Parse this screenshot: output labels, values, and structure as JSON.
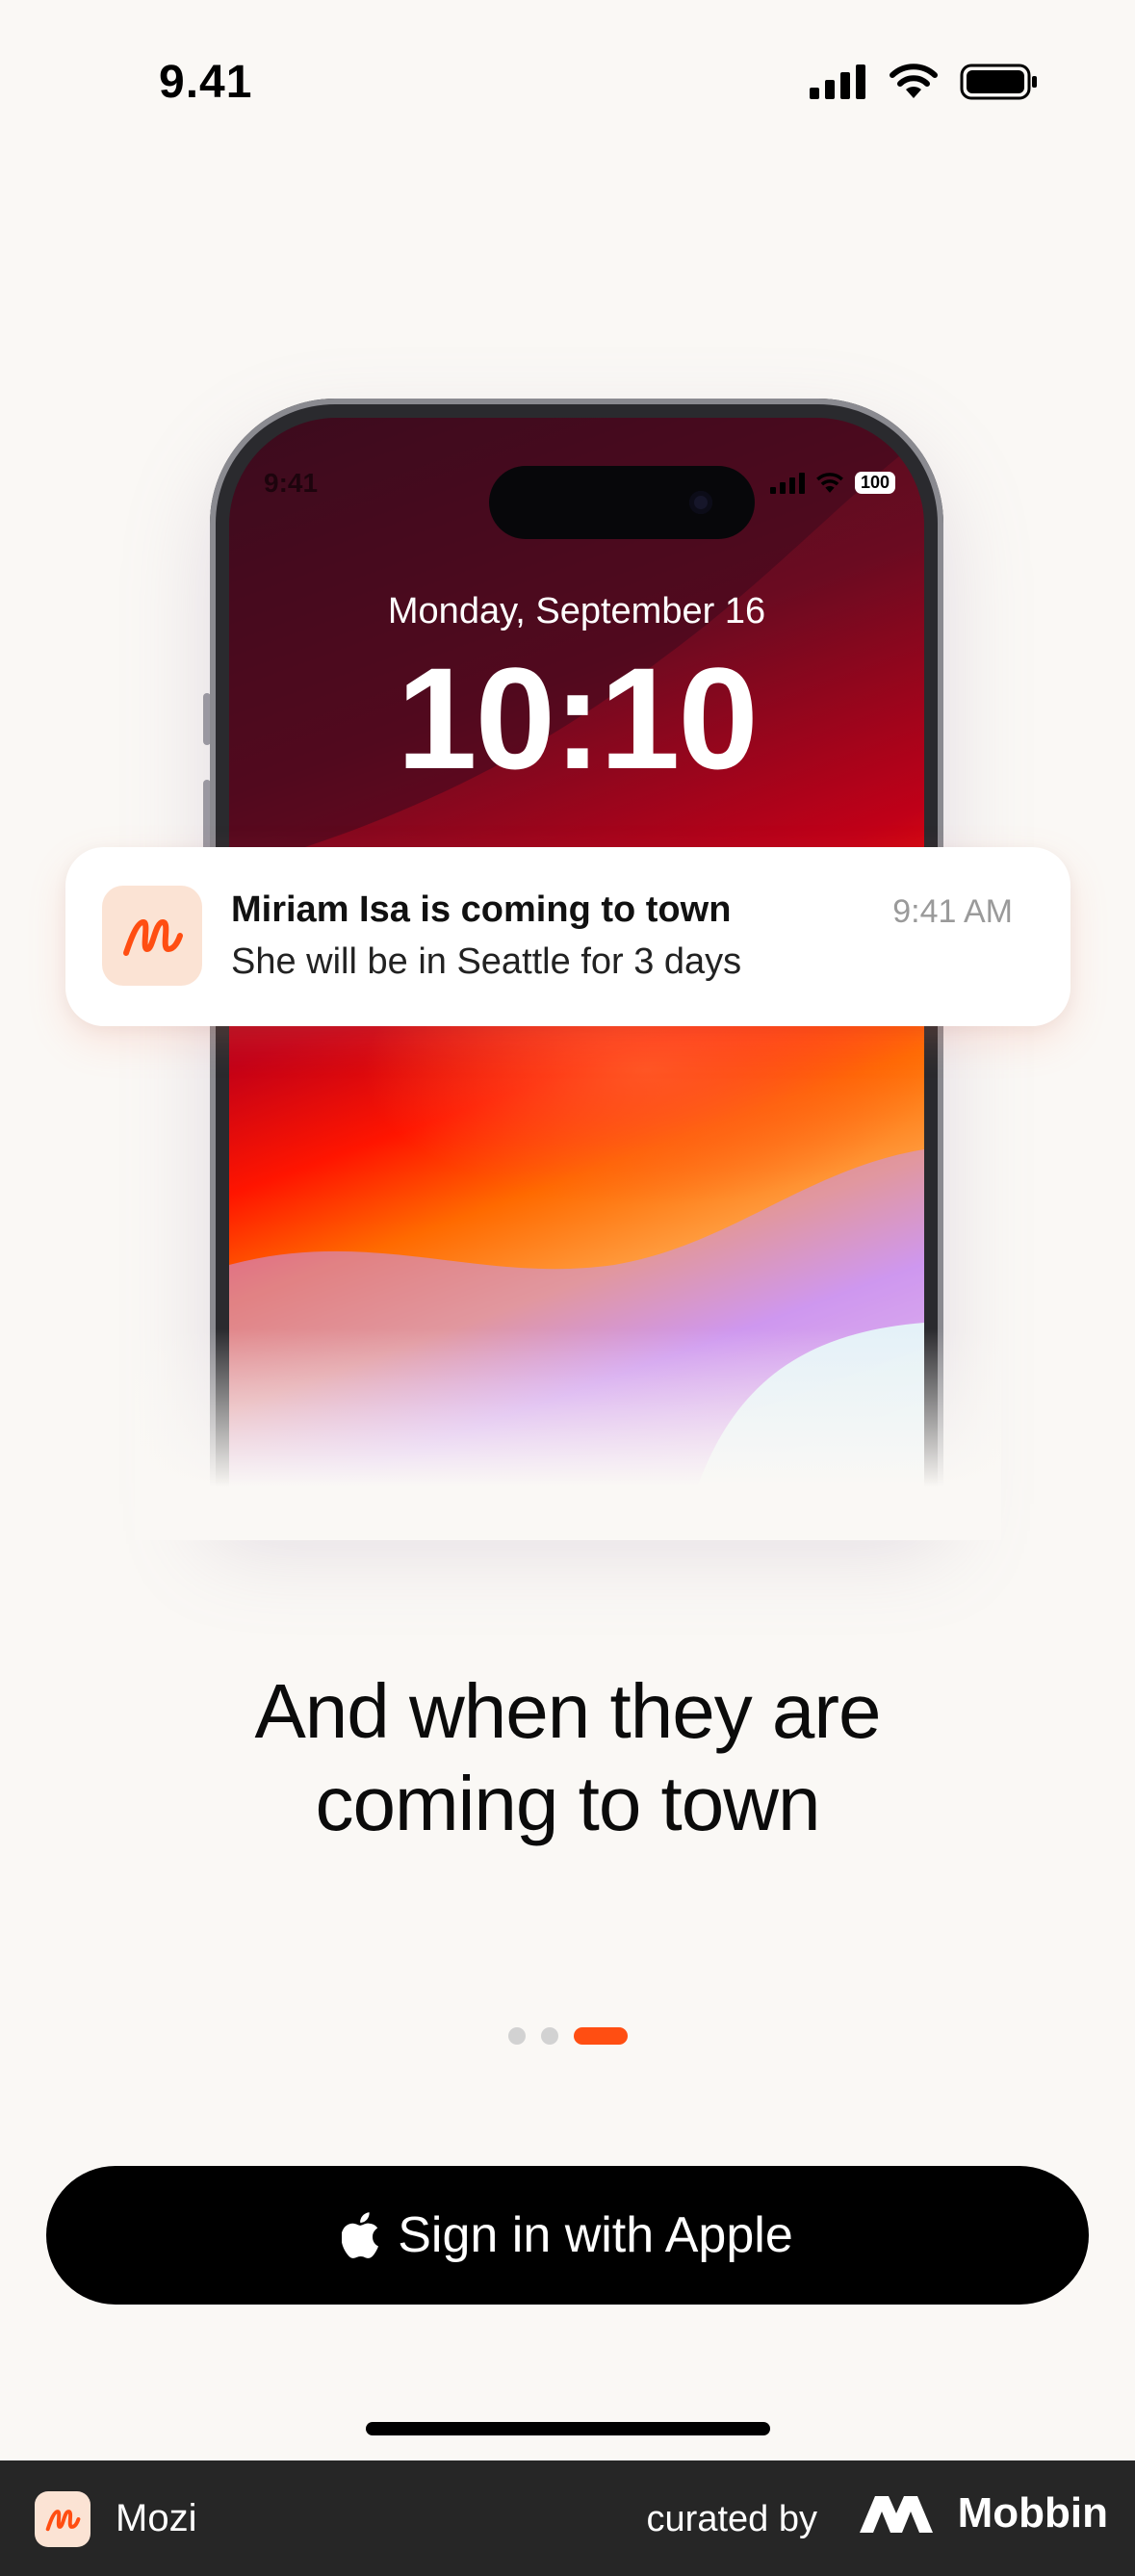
{
  "status_bar": {
    "time": "9.41"
  },
  "lock_screen": {
    "small_time": "9:41",
    "battery": "100",
    "date": "Monday, September 16",
    "clock": "10:10"
  },
  "notification": {
    "title": "Miriam Isa is coming to town",
    "body": "She will be in Seattle for 3 days",
    "time": "9:41 AM"
  },
  "onboarding": {
    "headline_line1": "And when they are",
    "headline_line2": "coming to town",
    "page_count": 3,
    "active_page": 3
  },
  "cta": {
    "label": "Sign in with Apple"
  },
  "footer": {
    "app_name": "Mozi",
    "curated_by": "curated by",
    "brand": "Mobbin"
  },
  "colors": {
    "accent": "#ff4e12",
    "background": "#faf8f5",
    "button": "#000000"
  }
}
